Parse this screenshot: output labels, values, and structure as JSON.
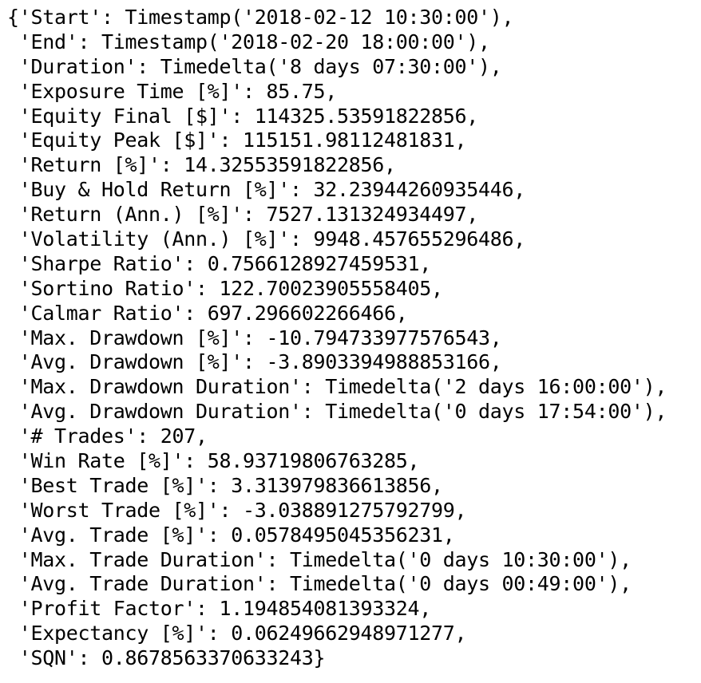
{
  "lines": [
    "{'Start': Timestamp('2018-02-12 10:30:00'),",
    " 'End': Timestamp('2018-02-20 18:00:00'),",
    " 'Duration': Timedelta('8 days 07:30:00'),",
    " 'Exposure Time [%]': 85.75,",
    " 'Equity Final [$]': 114325.53591822856,",
    " 'Equity Peak [$]': 115151.98112481831,",
    " 'Return [%]': 14.32553591822856,",
    " 'Buy & Hold Return [%]': 32.23944260935446,",
    " 'Return (Ann.) [%]': 7527.131324934497,",
    " 'Volatility (Ann.) [%]': 9948.457655296486,",
    " 'Sharpe Ratio': 0.7566128927459531,",
    " 'Sortino Ratio': 122.70023905558405,",
    " 'Calmar Ratio': 697.296602266466,",
    " 'Max. Drawdown [%]': -10.794733977576543,",
    " 'Avg. Drawdown [%]': -3.8903394988853166,",
    " 'Max. Drawdown Duration': Timedelta('2 days 16:00:00'),",
    " 'Avg. Drawdown Duration': Timedelta('0 days 17:54:00'),",
    " '# Trades': 207,",
    " 'Win Rate [%]': 58.93719806763285,",
    " 'Best Trade [%]': 3.313979836613856,",
    " 'Worst Trade [%]': -3.038891275792799,",
    " 'Avg. Trade [%]': 0.0578495045356231,",
    " 'Max. Trade Duration': Timedelta('0 days 10:30:00'),",
    " 'Avg. Trade Duration': Timedelta('0 days 00:49:00'),",
    " 'Profit Factor': 1.194854081393324,",
    " 'Expectancy [%]': 0.06249662948971277,",
    " 'SQN': 0.8678563370633243}"
  ]
}
